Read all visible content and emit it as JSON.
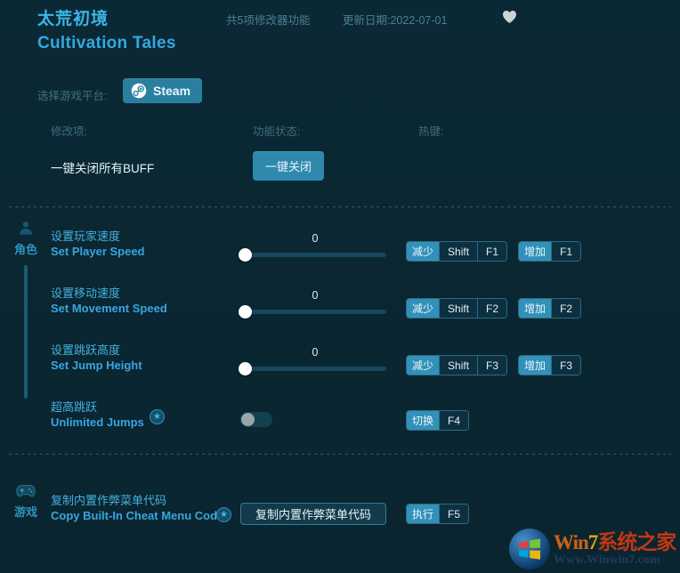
{
  "header": {
    "title_cn": "太荒初境",
    "title_en": "Cultivation Tales",
    "feature_count": "共5项修改器功能",
    "updated": "更新日期:2022-07-01",
    "favorite_icon": "heart-icon"
  },
  "platform": {
    "label": "选择游戏平台:",
    "selected": "Steam",
    "icon": "steam-icon"
  },
  "columns": {
    "name": "修改项:",
    "status": "功能状态:",
    "hotkey": "热键:"
  },
  "buff_row": {
    "name": "一键关闭所有BUFF",
    "button": "一键关闭"
  },
  "sections": [
    {
      "id": "character",
      "label_cn": "角色",
      "icon": "person-icon",
      "rows": [
        {
          "name_cn": "设置玩家速度",
          "name_en": "Set Player Speed",
          "control": "slider",
          "value": "0",
          "hotkeys": [
            {
              "action": "减少",
              "keys": [
                "Shift",
                "F1"
              ]
            },
            {
              "action": "增加",
              "keys": [
                "F1"
              ]
            }
          ]
        },
        {
          "name_cn": "设置移动速度",
          "name_en": "Set Movement Speed",
          "control": "slider",
          "value": "0",
          "hotkeys": [
            {
              "action": "减少",
              "keys": [
                "Shift",
                "F2"
              ]
            },
            {
              "action": "增加",
              "keys": [
                "F2"
              ]
            }
          ]
        },
        {
          "name_cn": "设置跳跃高度",
          "name_en": "Set Jump Height",
          "control": "slider",
          "value": "0",
          "hotkeys": [
            {
              "action": "减少",
              "keys": [
                "Shift",
                "F3"
              ]
            },
            {
              "action": "增加",
              "keys": [
                "F3"
              ]
            }
          ]
        },
        {
          "name_cn": "超高跳跃",
          "name_en": "Unlimited Jumps",
          "control": "toggle",
          "toggle_state": "off",
          "badge": "star-icon",
          "hotkeys": [
            {
              "action": "切换",
              "keys": [
                "F4"
              ]
            }
          ]
        }
      ]
    },
    {
      "id": "game",
      "label_cn": "游戏",
      "icon": "gamepad-icon",
      "rows": [
        {
          "name_cn": "复制内置作弊菜单代码",
          "name_en": "Copy Built-In Cheat Menu Code",
          "control": "button",
          "button_label": "复制内置作弊菜单代码",
          "badge": "star-icon",
          "hotkeys": [
            {
              "action": "执行",
              "keys": [
                "F5"
              ]
            }
          ]
        }
      ]
    }
  ],
  "watermark": {
    "brand_w": "W",
    "brand_in": "in",
    "brand_7": "7",
    "brand_cn": "系统之家",
    "url": "Www.Winwin7.com"
  },
  "colors": {
    "background": "#0a2733",
    "accent": "#3291b8",
    "title": "#39b7e8",
    "muted": "#44707f"
  }
}
